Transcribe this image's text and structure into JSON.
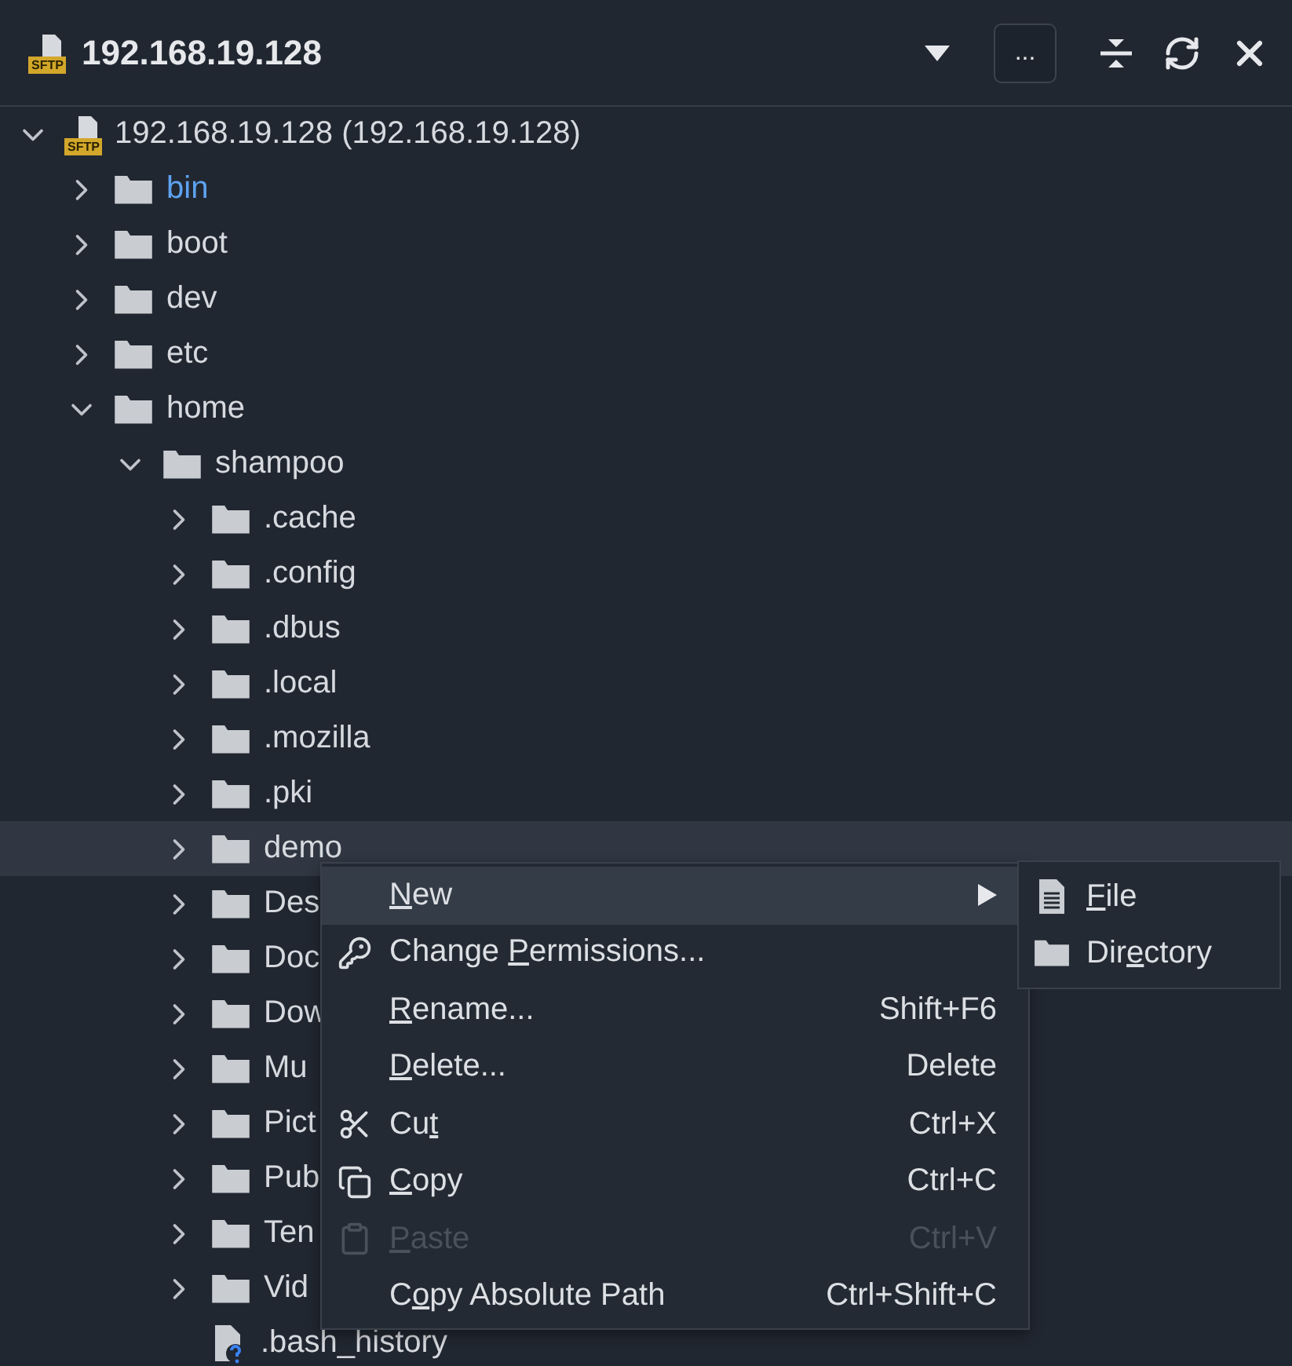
{
  "header": {
    "badge": "SFTP",
    "title": "192.168.19.128",
    "more_button": "..."
  },
  "tree": {
    "badge": "SFTP",
    "label": "192.168.19.128 (192.168.19.128)",
    "expanded": true,
    "children": [
      {
        "kind": "folder",
        "label": "bin",
        "expanded": false,
        "selected": false,
        "color": "#5ea2f0"
      },
      {
        "kind": "folder",
        "label": "boot",
        "expanded": false,
        "selected": false
      },
      {
        "kind": "folder",
        "label": "dev",
        "expanded": false,
        "selected": false
      },
      {
        "kind": "folder",
        "label": "etc",
        "expanded": false,
        "selected": false
      },
      {
        "kind": "folder",
        "label": "home",
        "expanded": true,
        "selected": false,
        "children": [
          {
            "kind": "folder",
            "label": "shampoo",
            "expanded": true,
            "selected": false,
            "children": [
              {
                "kind": "folder",
                "label": ".cache",
                "expanded": false,
                "selected": false
              },
              {
                "kind": "folder",
                "label": ".config",
                "expanded": false,
                "selected": false
              },
              {
                "kind": "folder",
                "label": ".dbus",
                "expanded": false,
                "selected": false
              },
              {
                "kind": "folder",
                "label": ".local",
                "expanded": false,
                "selected": false
              },
              {
                "kind": "folder",
                "label": ".mozilla",
                "expanded": false,
                "selected": false
              },
              {
                "kind": "folder",
                "label": ".pki",
                "expanded": false,
                "selected": false
              },
              {
                "kind": "folder",
                "label": "demo",
                "expanded": false,
                "selected": true
              },
              {
                "kind": "folder",
                "label": "Des",
                "expanded": false,
                "selected": false
              },
              {
                "kind": "folder",
                "label": "Doc",
                "expanded": false,
                "selected": false
              },
              {
                "kind": "folder",
                "label": "Dow",
                "expanded": false,
                "selected": false
              },
              {
                "kind": "folder",
                "label": "Mu",
                "expanded": false,
                "selected": false
              },
              {
                "kind": "folder",
                "label": "Pict",
                "expanded": false,
                "selected": false
              },
              {
                "kind": "folder",
                "label": "Pub",
                "expanded": false,
                "selected": false
              },
              {
                "kind": "folder",
                "label": "Ten",
                "expanded": false,
                "selected": false
              },
              {
                "kind": "folder",
                "label": "Vid",
                "expanded": false,
                "selected": false
              },
              {
                "kind": "file",
                "label": ".bash_history",
                "selected": false
              }
            ]
          }
        ]
      }
    ]
  },
  "context_menu": {
    "items": [
      {
        "kind": "submenu",
        "key": "N",
        "post": "ew",
        "selected": true,
        "disabled": false
      },
      {
        "kind": "permissions",
        "pre": "Change ",
        "key": "P",
        "post": "ermissions...",
        "selected": false,
        "disabled": false
      },
      {
        "kind": "plain",
        "key": "R",
        "post": "ename...",
        "shortcut": "Shift+F6",
        "selected": false,
        "disabled": false
      },
      {
        "kind": "plain",
        "key": "D",
        "post": "elete...",
        "shortcut": "Delete",
        "selected": false,
        "disabled": false
      },
      {
        "kind": "cut",
        "pre": "Cu",
        "key": "t",
        "shortcut": "Ctrl+X",
        "selected": false,
        "disabled": false
      },
      {
        "kind": "copy",
        "key": "C",
        "post": "opy",
        "shortcut": "Ctrl+C",
        "selected": false,
        "disabled": false
      },
      {
        "kind": "paste",
        "key": "P",
        "post": "aste",
        "shortcut": "Ctrl+V",
        "selected": false,
        "disabled": true
      },
      {
        "kind": "plain",
        "pre": "C",
        "key": "o",
        "post": "py Absolute Path",
        "shortcut": "Ctrl+Shift+C",
        "selected": false,
        "disabled": false
      }
    ]
  },
  "submenu": {
    "items": [
      {
        "kind": "file",
        "key": "F",
        "post": "ile"
      },
      {
        "kind": "folder",
        "pre": "Dir",
        "key": "e",
        "post": "ctory"
      }
    ]
  }
}
